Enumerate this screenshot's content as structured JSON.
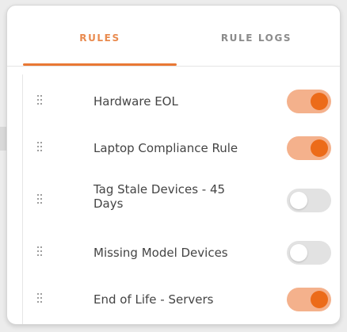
{
  "tabs": {
    "rules": "RULES",
    "rule_logs": "RULE LOGS",
    "active": "RULES"
  },
  "rules": [
    {
      "name": "Hardware EOL",
      "enabled": true
    },
    {
      "name": "Laptop Compliance Rule",
      "enabled": true
    },
    {
      "name": "Tag Stale Devices - 45 Days",
      "enabled": false
    },
    {
      "name": "Missing Model Devices",
      "enabled": false
    },
    {
      "name": "End of Life - Servers",
      "enabled": true
    }
  ],
  "colors": {
    "accent": "#e97834",
    "toggle_on_track": "#f4b18c",
    "toggle_on_knob": "#ec6b19",
    "toggle_off_track": "#e2e2e2",
    "toggle_off_knob": "#ffffff"
  },
  "icons": {
    "drag_handle": "drag-handle-icon"
  }
}
